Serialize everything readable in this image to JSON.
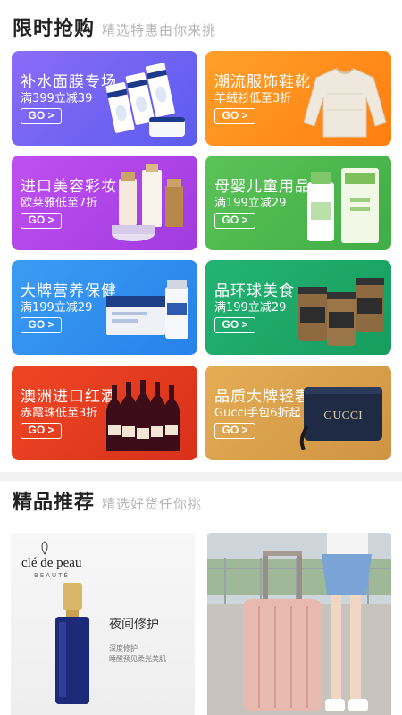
{
  "flash_sale": {
    "title": "限时抢购",
    "subtitle": "精选特惠由你来挑",
    "cards": [
      {
        "title": "补水面膜专场",
        "sub": "满399立减39",
        "go": "GO >",
        "color": "#6f63f5",
        "icon": "face-mask-icon"
      },
      {
        "title": "潮流服饰鞋靴",
        "sub": "羊绒衫低至3折",
        "go": "GO >",
        "color": "#ff8a1a",
        "icon": "sweater-icon"
      },
      {
        "title": "进口美容彩妆",
        "sub": "欧莱雅低至7折",
        "go": "GO >",
        "color": "#b44ae8",
        "icon": "cosmetics-icon"
      },
      {
        "title": "母婴儿童用品",
        "sub": "满199立减29",
        "go": "GO >",
        "color": "#4cb84f",
        "icon": "baby-bottle-icon"
      },
      {
        "title": "大牌营养保健",
        "sub": "满199立减29",
        "go": "GO >",
        "color": "#2e8ef0",
        "icon": "supplement-icon"
      },
      {
        "title": "品环球美食",
        "sub": "满199立减29",
        "go": "GO >",
        "color": "#1fa96a",
        "icon": "nuts-jar-icon"
      },
      {
        "title": "澳洲进口红酒",
        "sub": "赤霞珠低至3折",
        "go": "GO >",
        "color": "#e63a1e",
        "icon": "wine-bottle-icon"
      },
      {
        "title": "品质大牌轻奢",
        "sub": "Gucci手包6折起",
        "go": "GO >",
        "color": "#d9a24c",
        "icon": "clutch-bag-icon",
        "art_text": "GUCCI"
      }
    ]
  },
  "recommend": {
    "title": "精品推荐",
    "subtitle": "精选好货任你挑",
    "left": {
      "brand": "clé de peau",
      "brand_sub": "BEAUTÉ",
      "title": "夜间修护",
      "line1": "深度修护",
      "line2": "睡醒预见柔光美肌",
      "icon": "serum-bottle-icon"
    },
    "right": {
      "icon": "suitcase-icon"
    }
  }
}
